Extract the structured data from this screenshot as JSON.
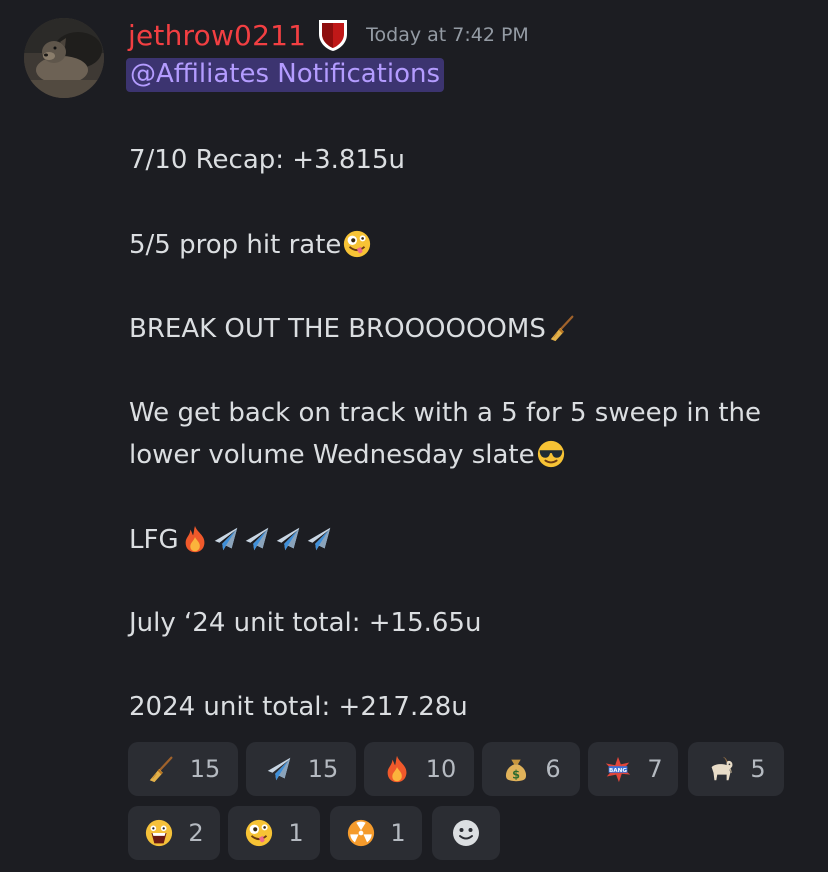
{
  "message": {
    "username": "jethrow0211",
    "timestamp": "Today at 7:42 PM",
    "mention": "@Affiliates Notifications",
    "lines": {
      "recap": "7/10 Recap: +3.815u",
      "hit_rate": "5/5 prop hit rate",
      "brooms": "BREAK OUT THE BROOOOOOMS",
      "track_1": "We get back on track with a 5 for 5 sweep in the",
      "track_2": "lower volume Wednesday slate",
      "lfg": "LFG",
      "july": "July ‘24 unit total: +15.65u",
      "year": "2024 unit total: +217.28u"
    },
    "emoji_names": {
      "hit_rate": "zany-face-emoji",
      "brooms": "broom-emoji",
      "track_2": "sunglasses-face-emoji",
      "lfg": [
        "fire-emoji",
        "airplane-emoji",
        "airplane-emoji",
        "airplane-emoji",
        "airplane-emoji"
      ]
    }
  },
  "reactions": [
    {
      "emoji": "broom-emoji",
      "count": "15"
    },
    {
      "emoji": "airplane-emoji",
      "count": "15"
    },
    {
      "emoji": "fire-emoji",
      "count": "10"
    },
    {
      "emoji": "money-bag-emoji",
      "count": "6"
    },
    {
      "emoji": "bang-custom-emoji",
      "count": "7"
    },
    {
      "emoji": "goat-emoji",
      "count": "5"
    },
    {
      "emoji": "screaming-custom-emoji",
      "count": "2"
    },
    {
      "emoji": "zany-face-emoji",
      "count": "1"
    },
    {
      "emoji": "radioactive-emoji",
      "count": "1"
    }
  ],
  "add_reaction_icon": "add-reaction-smiley-icon",
  "colors": {
    "background": "#1c1d22",
    "username": "#f23f42",
    "mention_bg": "#3c3470",
    "mention_text": "#b49cff",
    "reaction_bg": "#2b2d33"
  }
}
